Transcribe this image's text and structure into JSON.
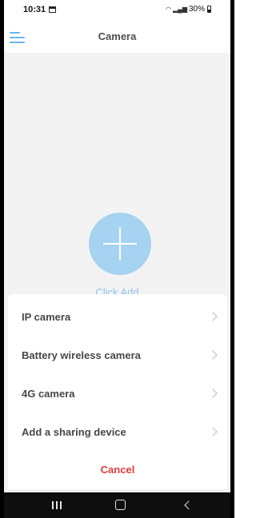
{
  "status_bar": {
    "time": "10:31",
    "battery": "30%",
    "icons": [
      "calendar-icon",
      "wifi-icon",
      "signal-icon",
      "battery-icon"
    ]
  },
  "header": {
    "title": "Camera",
    "menu_icon": "menu-icon"
  },
  "main": {
    "add_label": "Click Add",
    "add_icon": "plus-icon",
    "accent_color": "#a5d3f1"
  },
  "sheet": {
    "items": [
      {
        "label": "IP camera"
      },
      {
        "label": "Battery wireless camera"
      },
      {
        "label": "4G camera"
      },
      {
        "label": "Add a sharing device"
      }
    ],
    "cancel_label": "Cancel",
    "cancel_color": "#e23a3a"
  },
  "nav_bar": {
    "icons": [
      "recents-icon",
      "home-icon",
      "back-icon"
    ]
  }
}
